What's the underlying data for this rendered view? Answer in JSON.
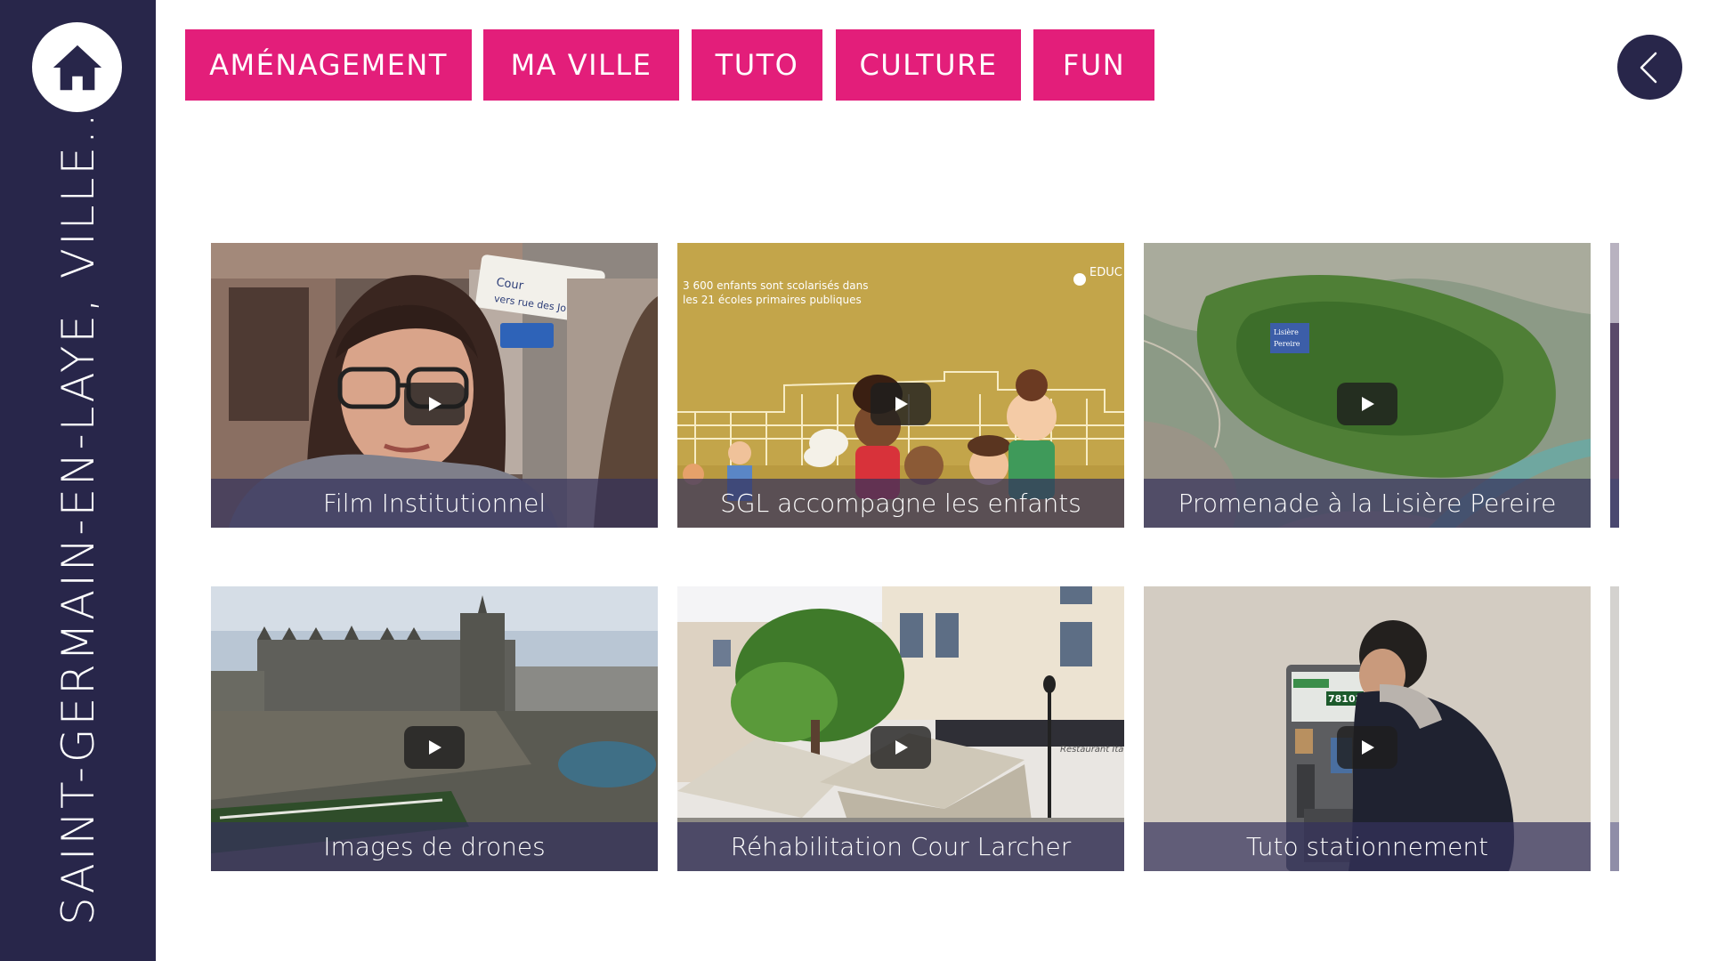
{
  "sidebar": {
    "title": "SAINT-GERMAIN-EN-LAYE, VILLE...",
    "home_icon": "home-icon"
  },
  "tabs": [
    {
      "label": "AMÉNAGEMENT"
    },
    {
      "label": "MA VILLE"
    },
    {
      "label": "TUTO"
    },
    {
      "label": "CULTURE"
    },
    {
      "label": "FUN"
    }
  ],
  "back_icon": "chevron-left-icon",
  "colors": {
    "sidebar": "#28264a",
    "tab": "#e31e7a",
    "caption_overlay": "#34325c"
  },
  "videos": [
    {
      "title": "Film Institutionnel",
      "thumb_sign_1": "Cour",
      "thumb_sign_2": "vers rue des Jo"
    },
    {
      "title": "SGL accompagne les enfants",
      "thumb_text_1": "3 600 enfants sont scolarisés dans",
      "thumb_text_2": "les 21 écoles primaires publiques",
      "thumb_corner": "EDUC"
    },
    {
      "title": "Promenade à la Lisière Pereire",
      "thumb_label_1": "Lisière",
      "thumb_label_2": "Pereire"
    },
    {
      "title": "Images de drones"
    },
    {
      "title": "Réhabilitation Cour Larcher",
      "thumb_sign": "Restaurant Ita"
    },
    {
      "title": "Tuto stationnement",
      "thumb_code": "78102"
    }
  ]
}
